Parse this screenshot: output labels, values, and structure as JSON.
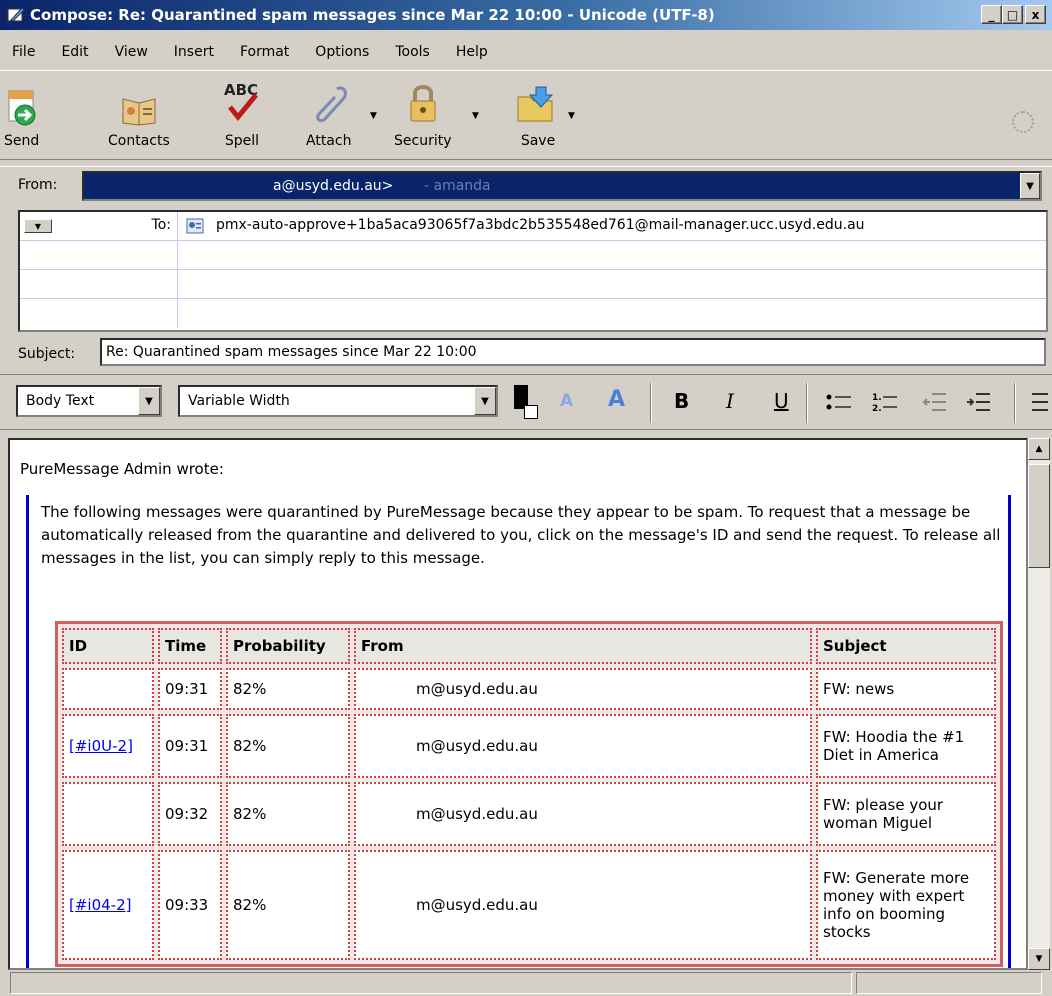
{
  "window": {
    "title": "Compose: Re: Quarantined spam messages since Mar 22 10:00 - Unicode (UTF-8)",
    "controls": [
      "_",
      "□",
      "x"
    ]
  },
  "menu": [
    "File",
    "Edit",
    "View",
    "Insert",
    "Format",
    "Options",
    "Tools",
    "Help"
  ],
  "toolbar": {
    "send": "Send",
    "contacts": "Contacts",
    "spell": "Spell",
    "spell_icon_text": "ABC",
    "attach": "Attach",
    "security": "Security",
    "save": "Save"
  },
  "header": {
    "from_label": "From:",
    "from_email": "a@usyd.edu.au>",
    "from_name": "- amanda",
    "to_label": "To:",
    "to_value": "pmx-auto-approve+1ba5aca93065f7a3bdc2b535548ed761@mail-manager.ucc.usyd.edu.au",
    "subject_label": "Subject:",
    "subject_value": "Re: Quarantined spam messages since Mar 22 10:00"
  },
  "format": {
    "paragraph_style": "Body Text",
    "font": "Variable Width",
    "bold": "B",
    "italic": "I",
    "underline": "U",
    "smaller": "A",
    "larger": "A"
  },
  "body": {
    "wrote": "PureMessage Admin wrote:",
    "intro": "The following messages were quarantined by PureMessage because they appear to be spam. To request that a message be automatically released from the quarantine and delivered to you, click on the message's ID and send the request. To release all messages in the list, you can simply reply to this message.",
    "table": {
      "headers": [
        "ID",
        "Time",
        "Probability",
        "From",
        "Subject"
      ],
      "rows": [
        {
          "id": "",
          "time": "09:31",
          "prob": "82%",
          "from": "m@usyd.edu.au",
          "subject": "FW: news"
        },
        {
          "id": "[#i0U-2]",
          "time": "09:31",
          "prob": "82%",
          "from": "m@usyd.edu.au",
          "subject": "FW: Hoodia the #1 Diet in America"
        },
        {
          "id": "",
          "time": "09:32",
          "prob": "82%",
          "from": "m@usyd.edu.au",
          "subject": "FW: please your woman Miguel"
        },
        {
          "id": "[#i04-2]",
          "time": "09:33",
          "prob": "82%",
          "from": "m@usyd.edu.au",
          "subject": "FW: Generate more money with expert info on booming stocks"
        }
      ]
    }
  },
  "colors": {
    "titlebar": "#0a246a",
    "from_highlight": "#0a246a",
    "quote_bar": "#0000cd",
    "table_border": "#d04040",
    "link": "#0000ee"
  }
}
